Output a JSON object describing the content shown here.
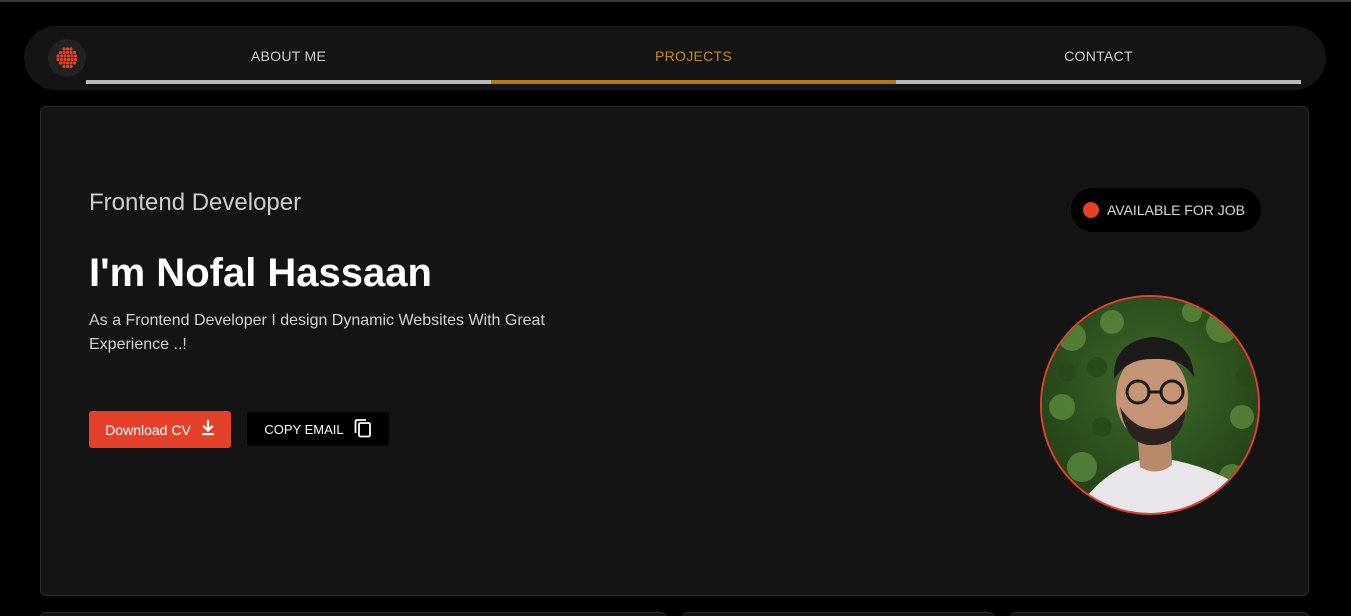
{
  "nav": {
    "logo_icon": "dot-grid-logo-icon",
    "tabs": [
      {
        "label": "ABOUT ME",
        "active": false
      },
      {
        "label": "PROJECTS",
        "active": true
      },
      {
        "label": "CONTACT",
        "active": false
      }
    ]
  },
  "hero": {
    "subtitle": "Frontend Developer",
    "headline": "I'm Nofal Hassaan",
    "description": "As a Frontend Developer I design Dynamic Websites With Great Experience ..!",
    "download_label": "Download CV",
    "download_icon": "download-icon",
    "copy_label": "COPY EMAIL",
    "copy_icon": "copy-icon",
    "badge_label": "AVAILABLE FOR JOB"
  },
  "colors": {
    "accent": "#e5412a",
    "active_tab": "#c28a1f",
    "background": "#000000",
    "card": "#141414"
  }
}
